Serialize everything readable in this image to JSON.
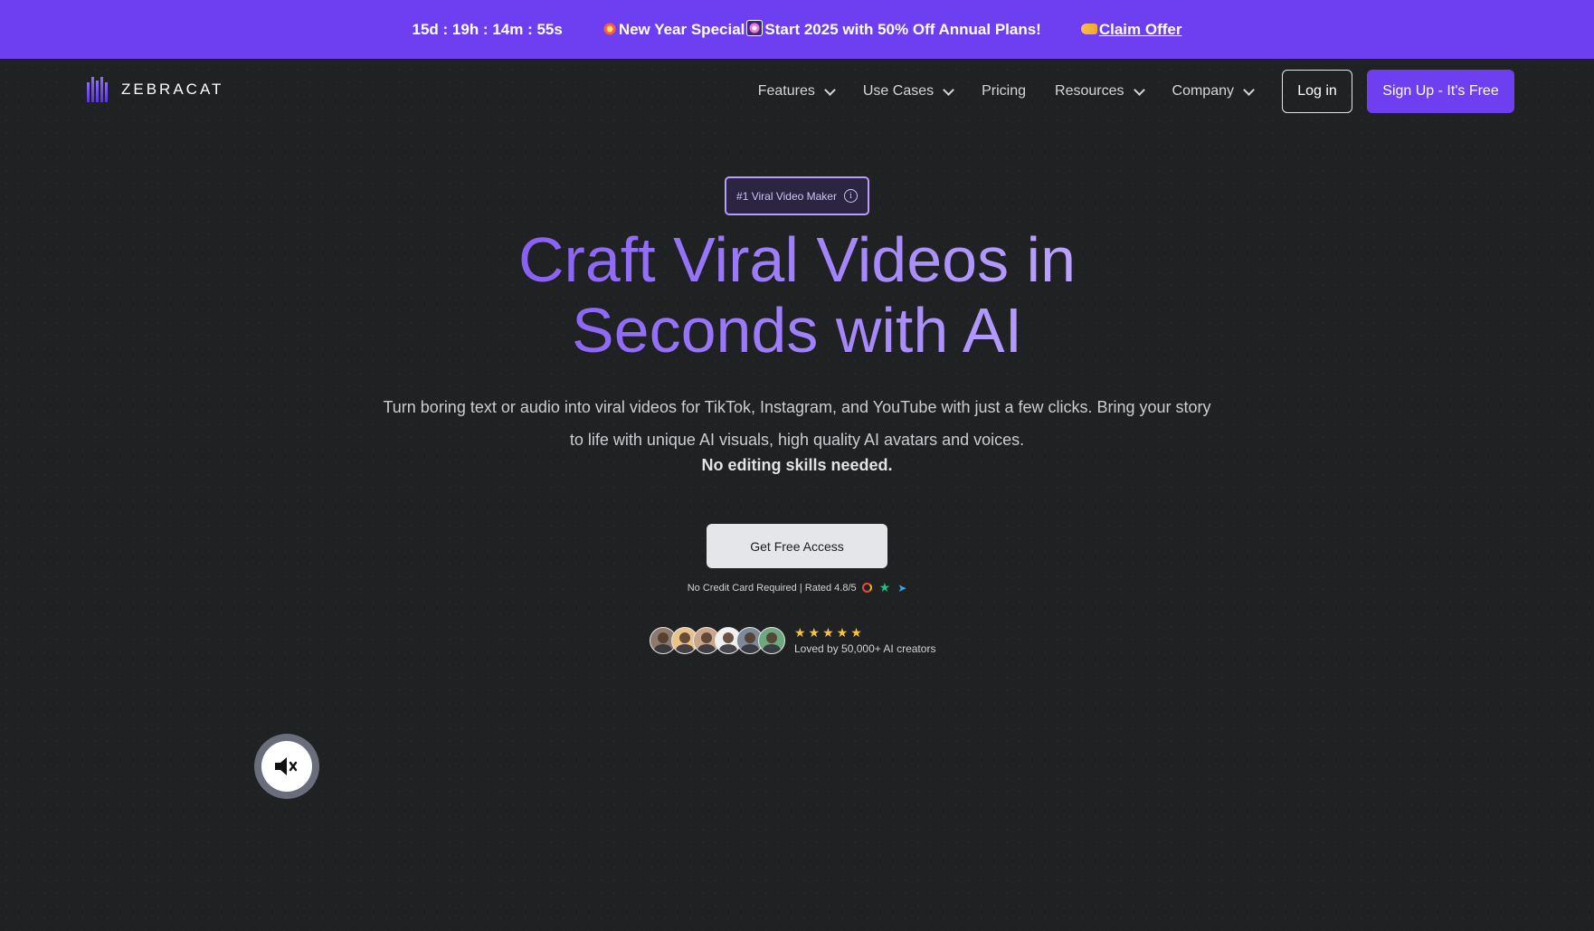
{
  "promo": {
    "timer": "15d : 19h : 14m : 55s",
    "message": "New Year Special",
    "message_tail": "Start 2025 with 50% Off Annual Plans!",
    "claim_label": "Claim Offer",
    "bg_color": "#6d3ff0"
  },
  "header": {
    "logo_text": "ZEBRACAT",
    "nav": [
      {
        "label": "Features",
        "has_dropdown": true
      },
      {
        "label": "Use Cases",
        "has_dropdown": true
      },
      {
        "label": "Pricing",
        "has_dropdown": false
      },
      {
        "label": "Resources",
        "has_dropdown": true
      },
      {
        "label": "Company",
        "has_dropdown": true
      }
    ],
    "login_label": "Log in",
    "signup_label": "Sign Up - It's Free"
  },
  "hero": {
    "badge": "#1 Viral Video Maker",
    "title_line1": "Craft Viral Videos in",
    "title_line2": "Seconds with AI",
    "subtitle": "Turn boring text or audio into viral videos for TikTok, Instagram, and YouTube with just a few clicks. Bring your story to life with unique AI visuals, high quality AI avatars and voices.",
    "subtitle_strong": "No editing skills needed.",
    "cta_label": "Get Free Access",
    "note": "No Credit Card Required | Rated 4.8/5",
    "stars": "★★★★★",
    "rating_stars": 5,
    "loved_text": "Loved by 50,000+ AI creators"
  },
  "icons": {
    "badge_info": "info-icon",
    "mute": "speaker-muted-icon",
    "rating_sources": [
      "google-icon",
      "trustpilot-star-icon",
      "capterra-icon"
    ]
  },
  "colors": {
    "accent": "#6d3ff0",
    "background": "#202123",
    "title_gradient_start": "#7a4cf0",
    "title_gradient_end": "#c9b8ff",
    "star_color": "#f5c242"
  }
}
